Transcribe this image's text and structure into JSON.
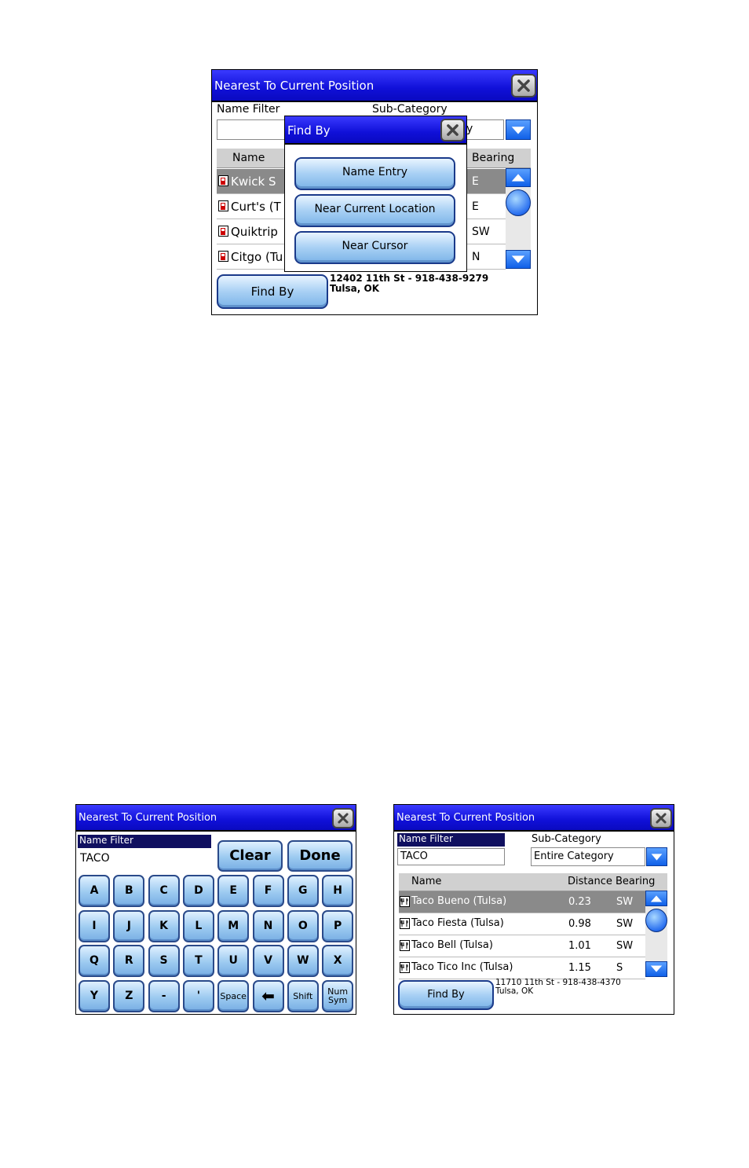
{
  "top": {
    "title": "Nearest To Current Position",
    "name_filter_label": "Name Filter",
    "sub_category_label": "Sub-Category",
    "sub_category_value_fragment": "y",
    "columns": {
      "name": "Name",
      "bearing": "Bearing"
    },
    "rows": [
      {
        "name": "Kwick S",
        "bearing": "E",
        "selected": true
      },
      {
        "name": "Curt's (T",
        "bearing": "E",
        "selected": false
      },
      {
        "name": "Quiktrip",
        "bearing": "SW",
        "selected": false
      },
      {
        "name": "Citgo (Tu",
        "bearing": "N",
        "selected": false
      }
    ],
    "find_by_label": "Find By",
    "address_line1": "12402 11th St - 918-438-9279",
    "address_line2": "Tulsa, OK",
    "popup": {
      "title": "Find By",
      "options": [
        "Name Entry",
        "Near Current Location",
        "Near Cursor"
      ]
    }
  },
  "keyboard": {
    "title": "Nearest To Current Position",
    "name_filter_label": "Name Filter",
    "name_filter_value": "TACO",
    "clear_label": "Clear",
    "done_label": "Done",
    "keys": [
      [
        "A",
        "B",
        "C",
        "D",
        "E",
        "F",
        "G",
        "H"
      ],
      [
        "I",
        "J",
        "K",
        "L",
        "M",
        "N",
        "O",
        "P"
      ],
      [
        "Q",
        "R",
        "S",
        "T",
        "U",
        "V",
        "W",
        "X"
      ],
      [
        "Y",
        "Z",
        "-",
        "'",
        "Space",
        "⬅",
        "Shift",
        "Num Sym"
      ]
    ]
  },
  "results": {
    "title": "Nearest To Current Position",
    "name_filter_label": "Name Filter",
    "name_filter_value": "TACO",
    "sub_category_label": "Sub-Category",
    "sub_category_value": "Entire Category",
    "columns": {
      "name": "Name",
      "distance": "Distance",
      "bearing": "Bearing"
    },
    "rows": [
      {
        "name": "Taco Bueno (Tulsa)",
        "distance": "0.23",
        "bearing": "SW",
        "selected": true
      },
      {
        "name": "Taco Fiesta (Tulsa)",
        "distance": "0.98",
        "bearing": "SW",
        "selected": false
      },
      {
        "name": "Taco Bell (Tulsa)",
        "distance": "1.01",
        "bearing": "SW",
        "selected": false
      },
      {
        "name": "Taco Tico Inc (Tulsa)",
        "distance": "1.15",
        "bearing": "S",
        "selected": false
      }
    ],
    "find_by_label": "Find By",
    "address_line1": "11710 11th St - 918-438-4370",
    "address_line2": "Tulsa, OK"
  },
  "icons": {
    "close": "close-x-icon",
    "dropdown": "chevron-down-icon",
    "scroll_up": "arrow-up-icon",
    "scroll_down": "arrow-down-icon",
    "fuel": "fuel-pump-icon",
    "restaurant": "restaurant-icon",
    "backspace": "backspace-arrow-icon"
  },
  "colors": {
    "titlebar": "#1a1ae6",
    "selected_row": "#8a8a8a",
    "button": "#9ccaf0"
  }
}
